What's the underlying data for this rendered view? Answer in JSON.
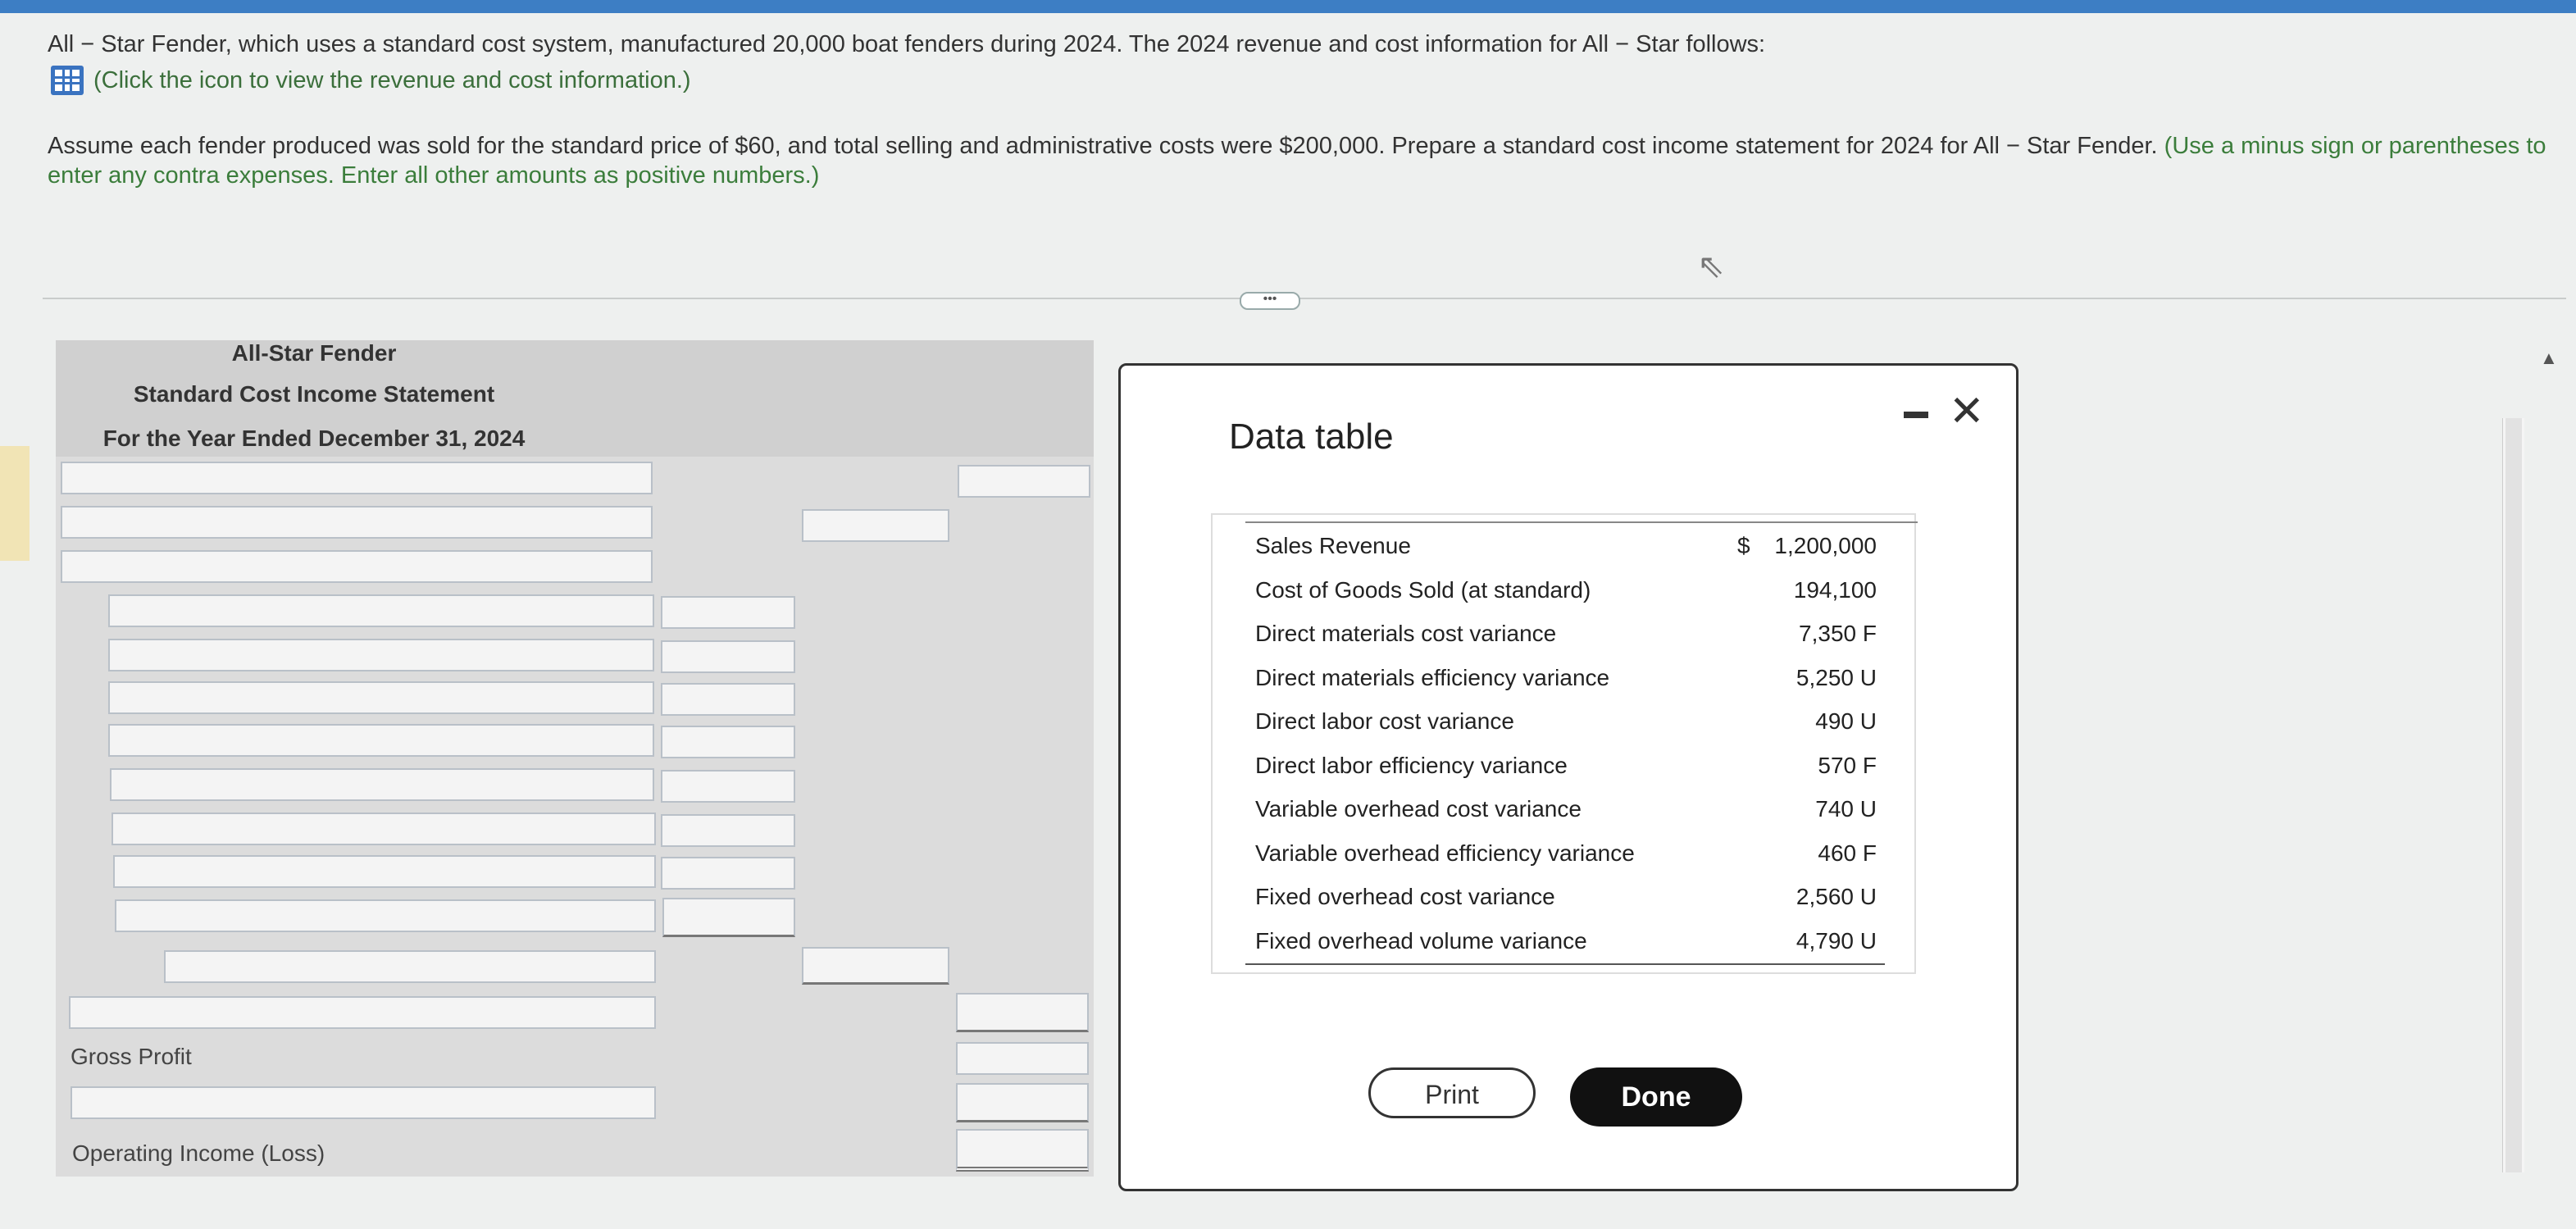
{
  "question": {
    "line1": "All − Star Fender, which uses a standard cost system, manufactured 20,000 boat fenders during 2024. The 2024 revenue and cost information for All − Star follows:",
    "link_text": "(Click the icon to view the revenue and cost information.)",
    "line3_main": "Assume each fender produced was sold for the standard price of $60, and total selling and administrative costs were $200,000. Prepare a standard cost income statement for 2024 for All − Star Fender.",
    "line3_hint": "(Use a minus sign or parentheses to enter any contra expenses. Enter all other amounts as positive numbers.)"
  },
  "statement": {
    "company": "All-Star Fender",
    "title": "Standard Cost Income Statement",
    "period": "For the Year Ended December 31, 2024",
    "gross_profit_label": "Gross Profit",
    "operating_income_label": "Operating Income (Loss)"
  },
  "modal": {
    "title": "Data table",
    "print_label": "Print",
    "done_label": "Done",
    "rows": [
      {
        "label": "Sales Revenue",
        "dollar": "$",
        "value": "1,200,000"
      },
      {
        "label": "Cost of Goods Sold (at standard)",
        "dollar": "",
        "value": "194,100"
      },
      {
        "label": "Direct materials cost variance",
        "dollar": "",
        "value": "7,350 F"
      },
      {
        "label": "Direct materials efficiency variance",
        "dollar": "",
        "value": "5,250 U"
      },
      {
        "label": "Direct labor cost variance",
        "dollar": "",
        "value": "490 U"
      },
      {
        "label": "Direct labor efficiency variance",
        "dollar": "",
        "value": "570 F"
      },
      {
        "label": "Variable overhead cost variance",
        "dollar": "",
        "value": "740 U"
      },
      {
        "label": "Variable overhead efficiency variance",
        "dollar": "",
        "value": "460 F"
      },
      {
        "label": "Fixed overhead cost variance",
        "dollar": "",
        "value": "2,560 U"
      },
      {
        "label": "Fixed overhead volume variance",
        "dollar": "",
        "value": "4,790 U"
      }
    ]
  },
  "icons": {
    "table": "table-grid-icon",
    "minimize": "minimize-icon",
    "close": "close-icon",
    "cursor": "mouse-cursor-icon"
  }
}
